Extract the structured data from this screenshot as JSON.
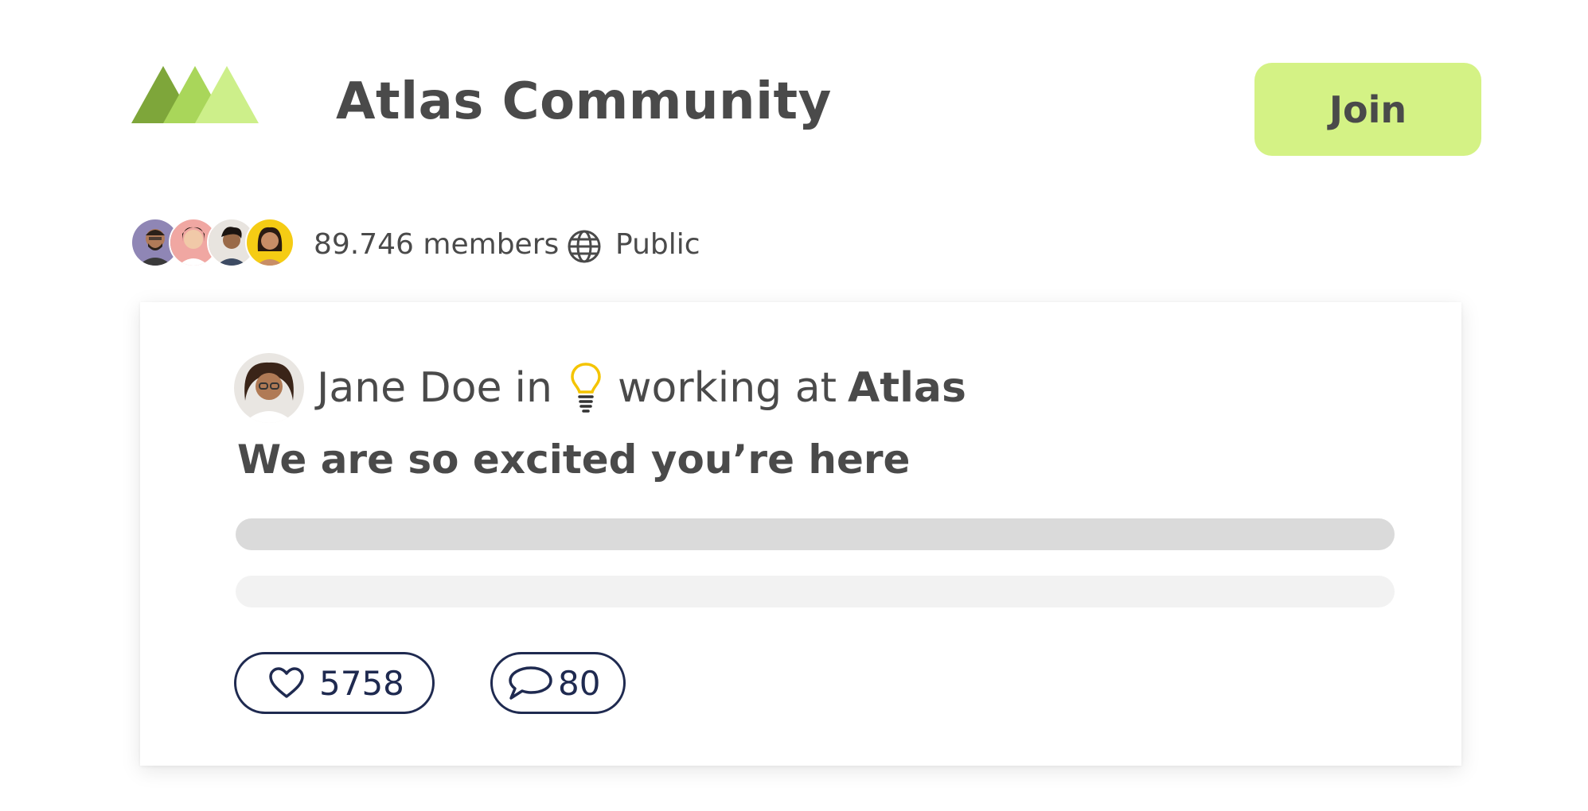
{
  "header": {
    "logo_icon": "mountains-logo-icon",
    "title": "Atlas Community",
    "join_label": "Join"
  },
  "meta": {
    "members": "89.746 members",
    "visibility_icon": "globe-icon",
    "visibility": "Public"
  },
  "post": {
    "author": "Jane Doe",
    "in_text": "in",
    "topic_icon": "lightbulb-icon",
    "topic": "working at",
    "organization": "Atlas",
    "title": "We are so excited you’re here",
    "likes": "5758",
    "comments": "80"
  },
  "colors": {
    "accent": "#d4f285",
    "text": "#4a4a4a",
    "navy": "#1f2a50",
    "logo_dark": "#7ea63a",
    "logo_mid": "#a9d65a",
    "logo_light": "#cdef8a",
    "bulb": "#f4c400"
  }
}
